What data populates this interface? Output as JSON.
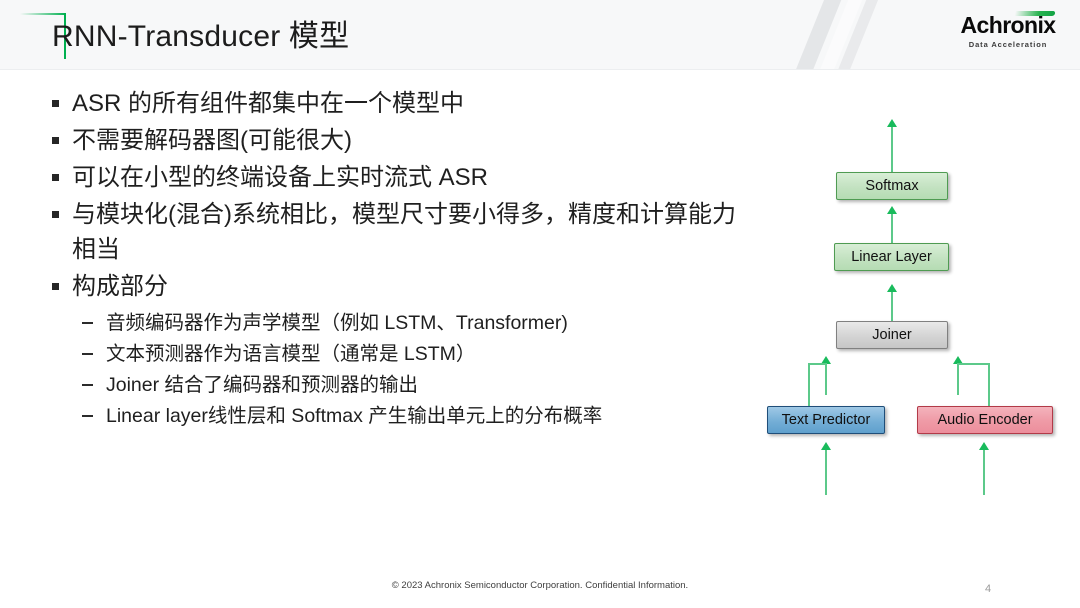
{
  "header": {
    "title": "RNN-Transducer 模型",
    "logo": {
      "name": "Achronix",
      "tagline": "Data Acceleration"
    }
  },
  "bullets": [
    {
      "text": "ASR 的所有组件都集中在一个模型中",
      "children": []
    },
    {
      "text": "不需要解码器图(可能很大)",
      "children": []
    },
    {
      "text": "可以在小型的终端设备上实时流式 ASR",
      "children": []
    },
    {
      "text": "与模块化(混合)系统相比，模型尺寸要小得多，精度和计算能力相当",
      "children": []
    },
    {
      "text": "构成部分",
      "children": [
        "音频编码器作为声学模型（例如 LSTM、Transformer)",
        "文本预测器作为语言模型（通常是 LSTM）",
        "Joiner 结合了编码器和预测器的输出",
        "Linear layer线性层和 Softmax 产生输出单元上的分布概率"
      ]
    }
  ],
  "diagram": {
    "nodes": [
      {
        "id": "softmax",
        "label": "Softmax",
        "color": "#c3e2c1"
      },
      {
        "id": "linear_layer",
        "label": "Linear Layer",
        "color": "#c3e2c1"
      },
      {
        "id": "joiner",
        "label": "Joiner",
        "color": "#d4d4d4"
      },
      {
        "id": "text_predictor",
        "label": "Text Predictor",
        "color": "#74aed6"
      },
      {
        "id": "audio_encoder",
        "label": "Audio Encoder",
        "color": "#ef9aa6"
      }
    ],
    "arrow_color": "#19bb5c"
  },
  "footer": {
    "copyright": "© 2023 Achronix Semiconductor Corporation. Confidential Information.",
    "page_number": "4"
  }
}
